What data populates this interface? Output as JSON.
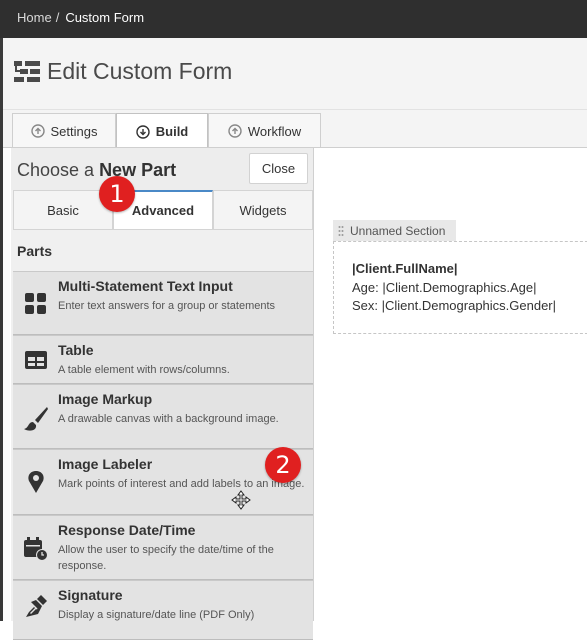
{
  "breadcrumb": {
    "home": "Home",
    "separator": "/",
    "current": "Custom Form"
  },
  "page": {
    "title": "Edit Custom Form",
    "icon": "form-builder-icon"
  },
  "tabs": [
    {
      "label": "Settings",
      "icon": "arrow-up-circle-icon",
      "active": false
    },
    {
      "label": "Build",
      "icon": "arrow-down-circle-icon",
      "active": true
    },
    {
      "label": "Workflow",
      "icon": "arrow-up-circle-icon",
      "active": false
    }
  ],
  "panel": {
    "title_prefix": "Choose a ",
    "title_bold": "New Part",
    "close_label": "Close",
    "subtabs": [
      {
        "label": "Basic",
        "active": false
      },
      {
        "label": "Advanced",
        "active": true
      },
      {
        "label": "Widgets",
        "active": false
      }
    ],
    "parts_label": "Parts",
    "parts": [
      {
        "name": "Multi-Statement Text Input",
        "description": "Enter text answers for a group or statements",
        "icon": "grid-icon"
      },
      {
        "name": "Table",
        "description": "A table element with rows/columns.",
        "icon": "table-icon"
      },
      {
        "name": "Image Markup",
        "description": "A drawable canvas with a background image.",
        "icon": "paintbrush-icon"
      },
      {
        "name": "Image Labeler",
        "description": "Mark points of interest and add labels to an image.",
        "icon": "pin-icon"
      },
      {
        "name": "Response Date/Time",
        "description": "Allow the user to specify the date/time of the response.",
        "icon": "calendar-clock-icon"
      },
      {
        "name": "Signature",
        "description": "Display a signature/date line (PDF Only)",
        "icon": "pen-nib-icon"
      }
    ]
  },
  "section": {
    "name": "Unnamed Section",
    "line1": "|Client.FullName|",
    "line2": "Age: |Client.Demographics.Age|",
    "line3": "Sex: |Client.Demographics.Gender|"
  },
  "annotations": {
    "badge1": "1",
    "badge2": "2"
  },
  "colors": {
    "topbar": "#2f2f2f",
    "badge": "#e02020",
    "active_tab_accent": "#4a89c7"
  }
}
